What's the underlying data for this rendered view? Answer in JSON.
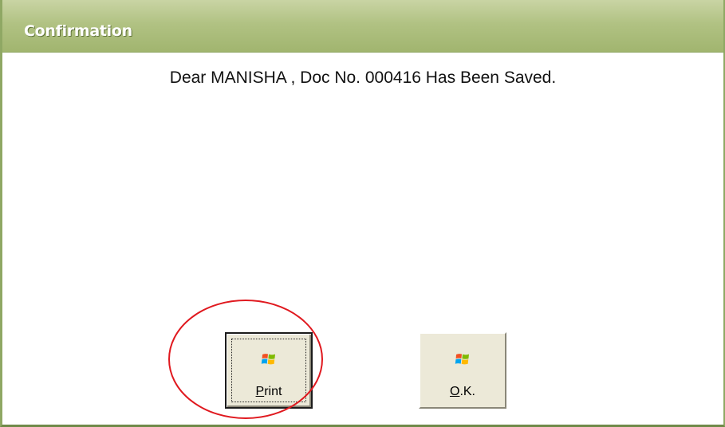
{
  "window": {
    "title": "Confirmation"
  },
  "message": {
    "text": "Dear MANISHA , Doc No. 000416 Has Been Saved."
  },
  "buttons": {
    "print": {
      "accel": "P",
      "rest": "rint",
      "icon": "windows-flag-icon"
    },
    "ok": {
      "accel": "O",
      "rest": ".K.",
      "icon": "windows-flag-icon"
    }
  },
  "colors": {
    "titlebar": "#b1c283",
    "annotation_circle": "#e0191f",
    "button_face": "#ece9d8"
  }
}
